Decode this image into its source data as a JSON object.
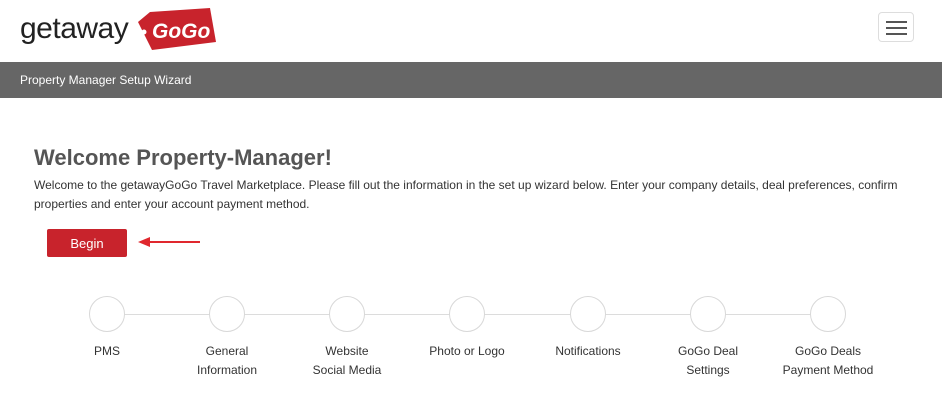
{
  "header": {
    "logo_text": "getaway",
    "logo_tag": "GoGo",
    "menu_icon": "hamburger-menu-icon"
  },
  "subbar": {
    "title": "Property Manager Setup Wizard"
  },
  "main": {
    "title": "Welcome Property-Manager!",
    "description": "Welcome to the getawayGoGo Travel Marketplace. Please fill out the information in the set up wizard below. Enter your company details, deal preferences, confirm properties and enter your account payment method.",
    "begin_label": "Begin"
  },
  "steps": [
    {
      "label": "PMS"
    },
    {
      "label": "General\nInformation"
    },
    {
      "label": "Website\nSocial Media"
    },
    {
      "label": "Photo or Logo"
    },
    {
      "label": "Notifications"
    },
    {
      "label": "GoGo Deal\nSettings"
    },
    {
      "label": "GoGo Deals\nPayment Method"
    }
  ],
  "colors": {
    "brand_red": "#c8232c",
    "subbar_gray": "#666666",
    "arrow_red": "#e0282e"
  }
}
